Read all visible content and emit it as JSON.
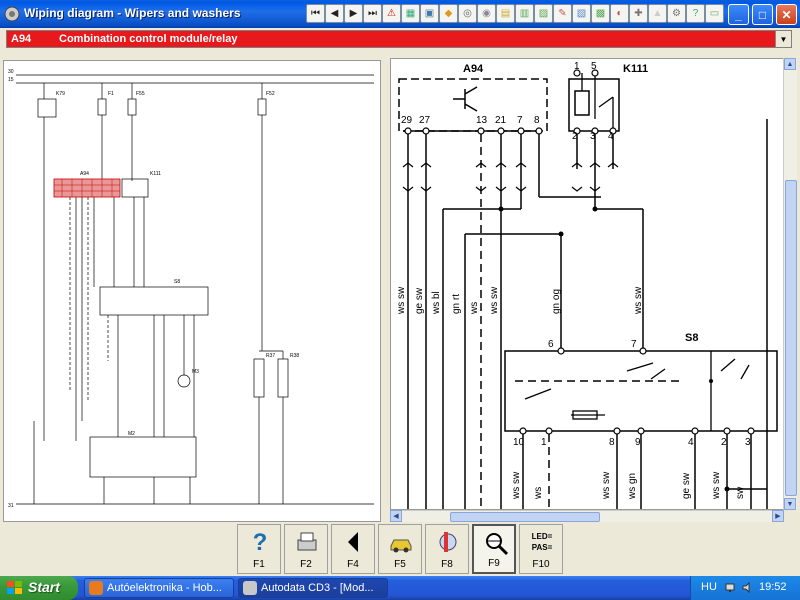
{
  "window": {
    "title": "Wiping diagram - Wipers and washers"
  },
  "toolbar": {
    "icons": [
      "first-page-icon",
      "prev-page-icon",
      "next-page-icon",
      "last-page-icon",
      "warning-icon",
      "data-icon",
      "image-icon",
      "car-icon",
      "tire-icon",
      "disc-icon",
      "folder-icon",
      "door-icon",
      "print-icon",
      "tools-icon",
      "edit-icon",
      "chart-icon",
      "tacho-icon",
      "wrench-icon",
      "car-lift-icon",
      "engine-icon",
      "help-icon",
      "card-icon"
    ]
  },
  "selector": {
    "code": "A94",
    "name": "Combination control module/relay"
  },
  "schematic_overview": {
    "rails": [
      "30",
      "15",
      "31"
    ],
    "labels": [
      "K79",
      "F1",
      "F55",
      "F52",
      "A94",
      "K111",
      "S8",
      "M2",
      "M3",
      "R37",
      "R38"
    ]
  },
  "schematic_detail": {
    "components": {
      "a94": "A94",
      "k111": "K111",
      "s8": "S8"
    },
    "a94_pins": [
      "29",
      "27",
      "13",
      "21",
      "7",
      "8"
    ],
    "k111_pins_top": [
      "1",
      "5"
    ],
    "k111_pins_bottom": [
      "2",
      "3",
      "4"
    ],
    "s8_pins_top": [
      "6",
      "7"
    ],
    "s8_pins_bottom": [
      "10",
      "1",
      "8",
      "9",
      "4",
      "2",
      "3"
    ],
    "wire_colors_upper": [
      "ws sw",
      "ge sw",
      "ws bl",
      "gn rt",
      "ws",
      "ws sw",
      "gn og",
      "ws sw"
    ],
    "wire_colors_lower": [
      "ws sw",
      "ws",
      "ws sw",
      "ws gn",
      "ge sw",
      "ws sw",
      "sw"
    ]
  },
  "function_keys": [
    {
      "key": "F1",
      "icon": "help-icon"
    },
    {
      "key": "F2",
      "icon": "print-icon"
    },
    {
      "key": "F4",
      "icon": "back-arrow-icon"
    },
    {
      "key": "F5",
      "icon": "car-icon"
    },
    {
      "key": "F8",
      "icon": "component-locate-icon"
    },
    {
      "key": "F9",
      "icon": "zoom-icon",
      "active": true
    },
    {
      "key": "F10",
      "icon": "led-pas-icon",
      "icon_text": "LED=\nPAS="
    }
  ],
  "taskbar": {
    "start": "Start",
    "tasks": [
      {
        "label": "Autóelektronika - Hob...",
        "icon": "firefox-icon"
      },
      {
        "label": "Autodata CD3 - [Mod...",
        "icon": "autodata-icon",
        "active": true
      }
    ],
    "tray": {
      "lang": "HU",
      "clock": "19:52"
    }
  }
}
